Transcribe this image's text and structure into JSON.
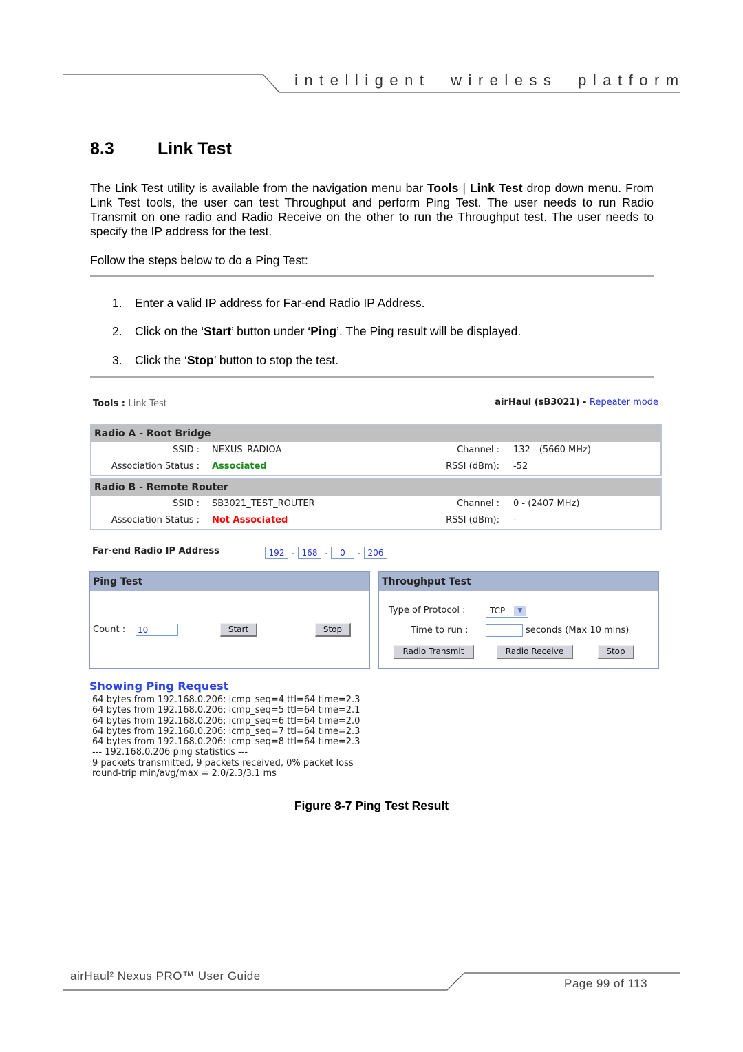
{
  "header": {
    "tagline": "intelligent wireless platform"
  },
  "section": {
    "number": "8.3",
    "title": "Link Test"
  },
  "intro": {
    "p1_a": "The Link Test utility is available from the navigation menu bar ",
    "p1_b": "Tools",
    "p1_c": " | ",
    "p1_d": "Link Test",
    "p1_e": " drop down menu. From Link Test tools, the user can test Throughput and perform Ping Test. The user needs to run Radio Transmit on one radio and Radio Receive on the other to run the Throughput test. The user needs to specify the IP address for the test.",
    "p2": "Follow the steps below to do a Ping Test:"
  },
  "steps": [
    {
      "n": "1.",
      "a": "Enter a valid IP address for Far-end Radio IP Address."
    },
    {
      "n": "2.",
      "a": "Click on the ‘",
      "b": "Start",
      "c": "’ button under ‘",
      "d": "Ping",
      "e": "’. The Ping result will be displayed."
    },
    {
      "n": "3.",
      "a": "Click the ‘",
      "b": "Stop",
      "c": "’ button to stop the test."
    }
  ],
  "ui": {
    "breadcrumb_a": "Tools : ",
    "breadcrumb_b": "Link Test",
    "device": "airHaul (sB3021) - ",
    "mode_link": "Repeater mode",
    "radio_a": {
      "title": "Radio A - Root Bridge",
      "ssid_label": "SSID :",
      "ssid": "NEXUS_RADIOA",
      "assoc_label": "Association Status :",
      "assoc": "Associated",
      "channel_label": "Channel :",
      "channel": "132 - (5660 MHz)",
      "rssi_label": "RSSI (dBm):",
      "rssi": "-52"
    },
    "radio_b": {
      "title": "Radio B - Remote Router",
      "ssid_label": "SSID :",
      "ssid": "SB3021_TEST_ROUTER",
      "assoc_label": "Association Status :",
      "assoc": "Not Associated",
      "channel_label": "Channel :",
      "channel": "0 - (2407 MHz)",
      "rssi_label": "RSSI (dBm):",
      "rssi": "-"
    },
    "ip_label": "Far-end Radio IP Address",
    "ip": [
      "192",
      "168",
      "0",
      "206"
    ],
    "ping": {
      "title": "Ping Test",
      "count_label": "Count :",
      "count": "10",
      "start": "Start",
      "stop": "Stop"
    },
    "throughput": {
      "title": "Throughput Test",
      "protocol_label": "Type of Protocol :",
      "protocol": "TCP",
      "time_label": "Time to run  :",
      "time": "",
      "seconds": "seconds  (Max 10 mins)",
      "transmit": "Radio Transmit",
      "receive": "Radio Receive",
      "stop": "Stop"
    },
    "result_title": "Showing Ping Request",
    "result_lines": [
      "64 bytes from 192.168.0.206: icmp_seq=4 ttl=64 time=2.3",
      "64 bytes from 192.168.0.206: icmp_seq=5 ttl=64 time=2.1",
      "64 bytes from 192.168.0.206: icmp_seq=6 ttl=64 time=2.0",
      "64 bytes from 192.168.0.206: icmp_seq=7 ttl=64 time=2.3",
      "64 bytes from 192.168.0.206: icmp_seq=8 ttl=64 time=2.3",
      "--- 192.168.0.206 ping statistics ---",
      "9 packets transmitted, 9 packets received, 0% packet loss",
      "round-trip min/avg/max = 2.0/2.3/3.1 ms"
    ],
    "colors": {
      "associated": "#1a8a1a",
      "not_associated": "#ff0000",
      "link": "#2233cc",
      "header_bar": "#a9b6d2"
    }
  },
  "caption": "Figure 8-7 Ping Test Result",
  "footer": {
    "guide": "airHaul² Nexus PRO™ User Guide",
    "page": "Page 99 of 113"
  }
}
